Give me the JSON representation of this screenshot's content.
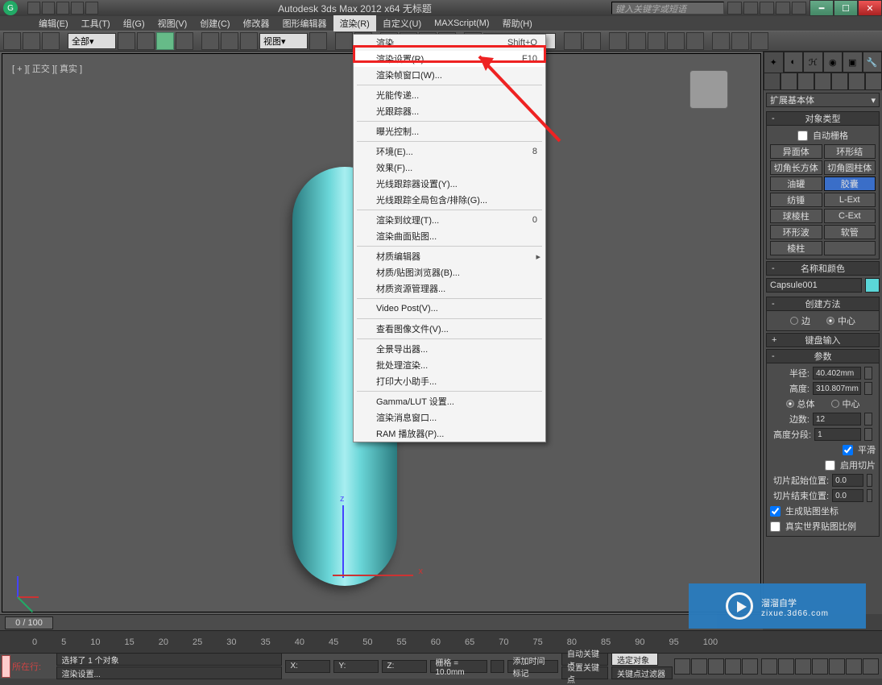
{
  "titlebar": {
    "title": "Autodesk 3ds Max  2012 x64   无标题",
    "search_placeholder": "键入关键字或短语"
  },
  "menubar": {
    "items": [
      "编辑(E)",
      "工具(T)",
      "组(G)",
      "视图(V)",
      "创建(C)",
      "修改器",
      "图形编辑器",
      "渲染(R)",
      "自定义(U)",
      "MAXScript(M)",
      "帮助(H)"
    ],
    "active_index": 7
  },
  "main_toolbar": {
    "selection_filter": "全部",
    "ref_coord": "视图"
  },
  "viewport": {
    "label": "[ + ][ 正交 ][ 真实 ]"
  },
  "render_menu": {
    "items": [
      {
        "label": "渲染",
        "shortcut": "Shift+Q"
      },
      {
        "label": "渲染设置(R)...",
        "shortcut": "F10",
        "highlight": true
      },
      {
        "label": "渲染帧窗口(W)..."
      },
      "sep",
      {
        "label": "光能传递..."
      },
      {
        "label": "光跟踪器..."
      },
      "sep",
      {
        "label": "曝光控制..."
      },
      "sep",
      {
        "label": "环境(E)...",
        "shortcut": "8"
      },
      {
        "label": "效果(F)..."
      },
      {
        "label": "光线跟踪器设置(Y)..."
      },
      {
        "label": "光线跟踪全局包含/排除(G)..."
      },
      "sep",
      {
        "label": "渲染到纹理(T)...",
        "shortcut": "0"
      },
      {
        "label": "渲染曲面贴图..."
      },
      "sep",
      {
        "label": "材质编辑器",
        "sub": true
      },
      {
        "label": "材质/贴图浏览器(B)..."
      },
      {
        "label": "材质资源管理器..."
      },
      "sep",
      {
        "label": "Video Post(V)..."
      },
      "sep",
      {
        "label": "查看图像文件(V)..."
      },
      "sep",
      {
        "label": "全景导出器..."
      },
      {
        "label": "批处理渲染..."
      },
      {
        "label": "打印大小助手..."
      },
      "sep",
      {
        "label": "Gamma/LUT 设置..."
      },
      {
        "label": "渲染消息窗口..."
      },
      {
        "label": "RAM 播放器(P)..."
      }
    ]
  },
  "cmd_panel": {
    "category": "扩展基本体",
    "obj_type_hdr": "对象类型",
    "autogrid": "自动栅格",
    "buttons": [
      "异面体",
      "环形结",
      "切角长方体",
      "切角圆柱体",
      "油罐",
      "胶囊",
      "纺锤",
      "L-Ext",
      "球棱柱",
      "C-Ext",
      "环形波",
      "软管",
      "棱柱",
      ""
    ],
    "active_button_index": 5,
    "name_hdr": "名称和颜色",
    "object_name": "Capsule001",
    "create_hdr": "创建方法",
    "create_radios": [
      "边",
      "中心"
    ],
    "create_radio_sel": 1,
    "kb_hdr": "键盘输入",
    "params_hdr": "参数",
    "radius_lbl": "半径:",
    "radius_val": "40.402mm",
    "height_lbl": "高度:",
    "height_val": "310.807mm",
    "overall_radios": [
      "总体",
      "中心"
    ],
    "overall_sel": 0,
    "sides_lbl": "边数:",
    "sides_val": "12",
    "hsegs_lbl": "高度分段:",
    "hsegs_val": "1",
    "smooth": "平滑",
    "slice_on": "启用切片",
    "slice_from_lbl": "切片起始位置:",
    "slice_from_val": "0.0",
    "slice_to_lbl": "切片结束位置:",
    "slice_to_val": "0.0",
    "gen_map": "生成贴图坐标",
    "real_world": "真实世界贴图比例"
  },
  "timeslider": {
    "frame": "0 / 100"
  },
  "trackbar": {
    "ticks": [
      "0",
      "5",
      "10",
      "15",
      "20",
      "25",
      "30",
      "35",
      "40",
      "45",
      "50",
      "55",
      "60",
      "65",
      "70",
      "75",
      "80",
      "85",
      "90",
      "95",
      "100"
    ]
  },
  "statusbar": {
    "left_label": "所在行:",
    "sel_info": "选择了 1 个对象",
    "prompt": "渲染设置...",
    "x": "X:",
    "y": "Y:",
    "z": "Z:",
    "grid": "栅格 = 10.0mm",
    "autokey": "自动关键点",
    "selected": "选定对象",
    "setkey": "设置关键点",
    "keyfilter": "关键点过滤器",
    "addtime": "添加时间标记"
  },
  "watermark": {
    "main": "溜溜自学",
    "sub": "zixue.3d66.com"
  }
}
